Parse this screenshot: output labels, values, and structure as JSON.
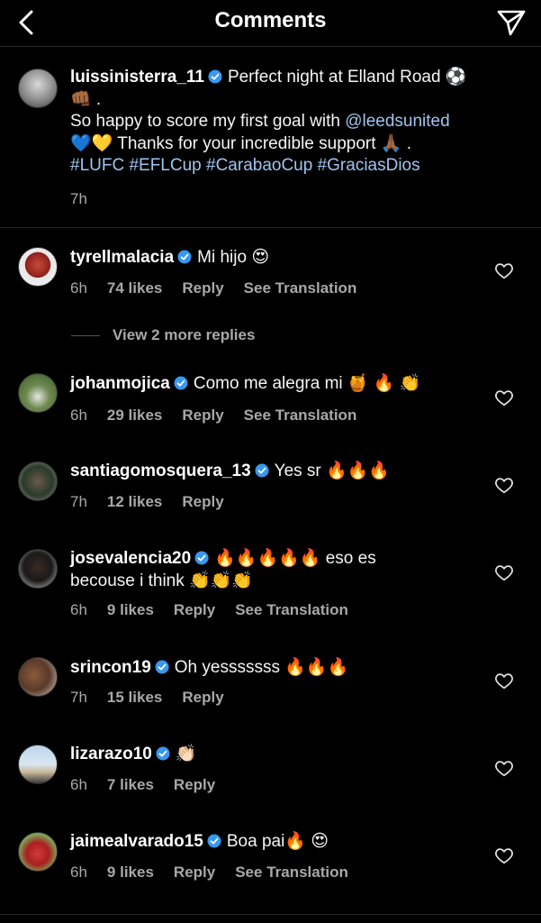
{
  "header": {
    "title": "Comments"
  },
  "caption": {
    "username": "luissinisterra_11",
    "text_line1": "Perfect night at Elland Road ⚽",
    "text_line2": "👊🏾 .",
    "text_line3_pre": "So happy to score my first goal with ",
    "mention": "@leedsunited",
    "text_line4": "💙💛 Thanks for your incredible support 🙏🏾 .",
    "hashtags": "#LUFC #EFLCup #CarabaoCup #GraciasDios",
    "time": "7h"
  },
  "view_replies": "View 2 more replies",
  "comments": [
    {
      "username": "tyrellmalacia",
      "text": "Mi hijo 😍",
      "time": "6h",
      "likes": "74 likes",
      "reply": "Reply",
      "translate": "See Translation"
    },
    {
      "username": "johanmojica",
      "text": "Como me alegra mi 🍯 🔥 👏",
      "time": "6h",
      "likes": "29 likes",
      "reply": "Reply",
      "translate": "See Translation"
    },
    {
      "username": "santiagomosquera_13",
      "text": "Yes sr 🔥🔥🔥",
      "time": "7h",
      "likes": "12 likes",
      "reply": "Reply",
      "translate": ""
    },
    {
      "username": "josevalencia20",
      "text": "🔥🔥🔥🔥🔥 eso es",
      "text2": "becouse i think 👏👏👏",
      "time": "6h",
      "likes": "9 likes",
      "reply": "Reply",
      "translate": "See Translation"
    },
    {
      "username": "srincon19",
      "text": "Oh yesssssss 🔥🔥🔥",
      "time": "7h",
      "likes": "15 likes",
      "reply": "Reply",
      "translate": ""
    },
    {
      "username": "lizarazo10",
      "text": "👏🏻",
      "time": "6h",
      "likes": "7 likes",
      "reply": "Reply",
      "translate": ""
    },
    {
      "username": "jaimealvarado15",
      "text": "Boa pai🔥 😍",
      "time": "6h",
      "likes": "9 likes",
      "reply": "Reply",
      "translate": "See Translation"
    }
  ],
  "colors": {
    "background": "#000000",
    "secondary_text": "#a8a8a8",
    "link": "#9fc4ef",
    "verified": "#3897f0"
  }
}
